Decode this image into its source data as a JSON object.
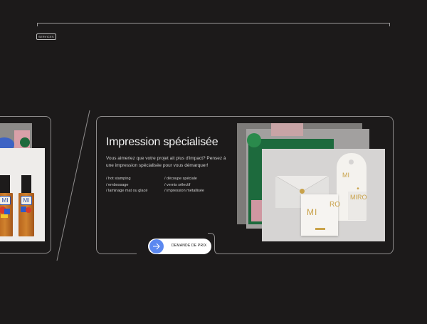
{
  "section_tag": "SERVICES",
  "card": {
    "title": "Impression spécialisée",
    "description": "Vous aimeriez que votre projet ait plus d'impact? Pensez à une impression spécialisée pour vous démarquer!",
    "features_col1": [
      "/ hot stamping",
      "/ embossage",
      "/ laminage mat ou glacé"
    ],
    "features_col2": [
      "/ découpe spéciale",
      "/ vernis sélectif",
      "/ impression métallisée"
    ]
  },
  "cta": {
    "label": "DEMANDE DE PRIX",
    "icon": "arrow-right-icon"
  },
  "artwork": {
    "bottle_label": "MI",
    "tag_text": "MI",
    "card_text": "MI",
    "card_text2": "RO",
    "roll_text": "MIRO"
  },
  "colors": {
    "background": "#1c1a1a",
    "accent": "#5b88f0",
    "gold": "#c9a24a"
  }
}
